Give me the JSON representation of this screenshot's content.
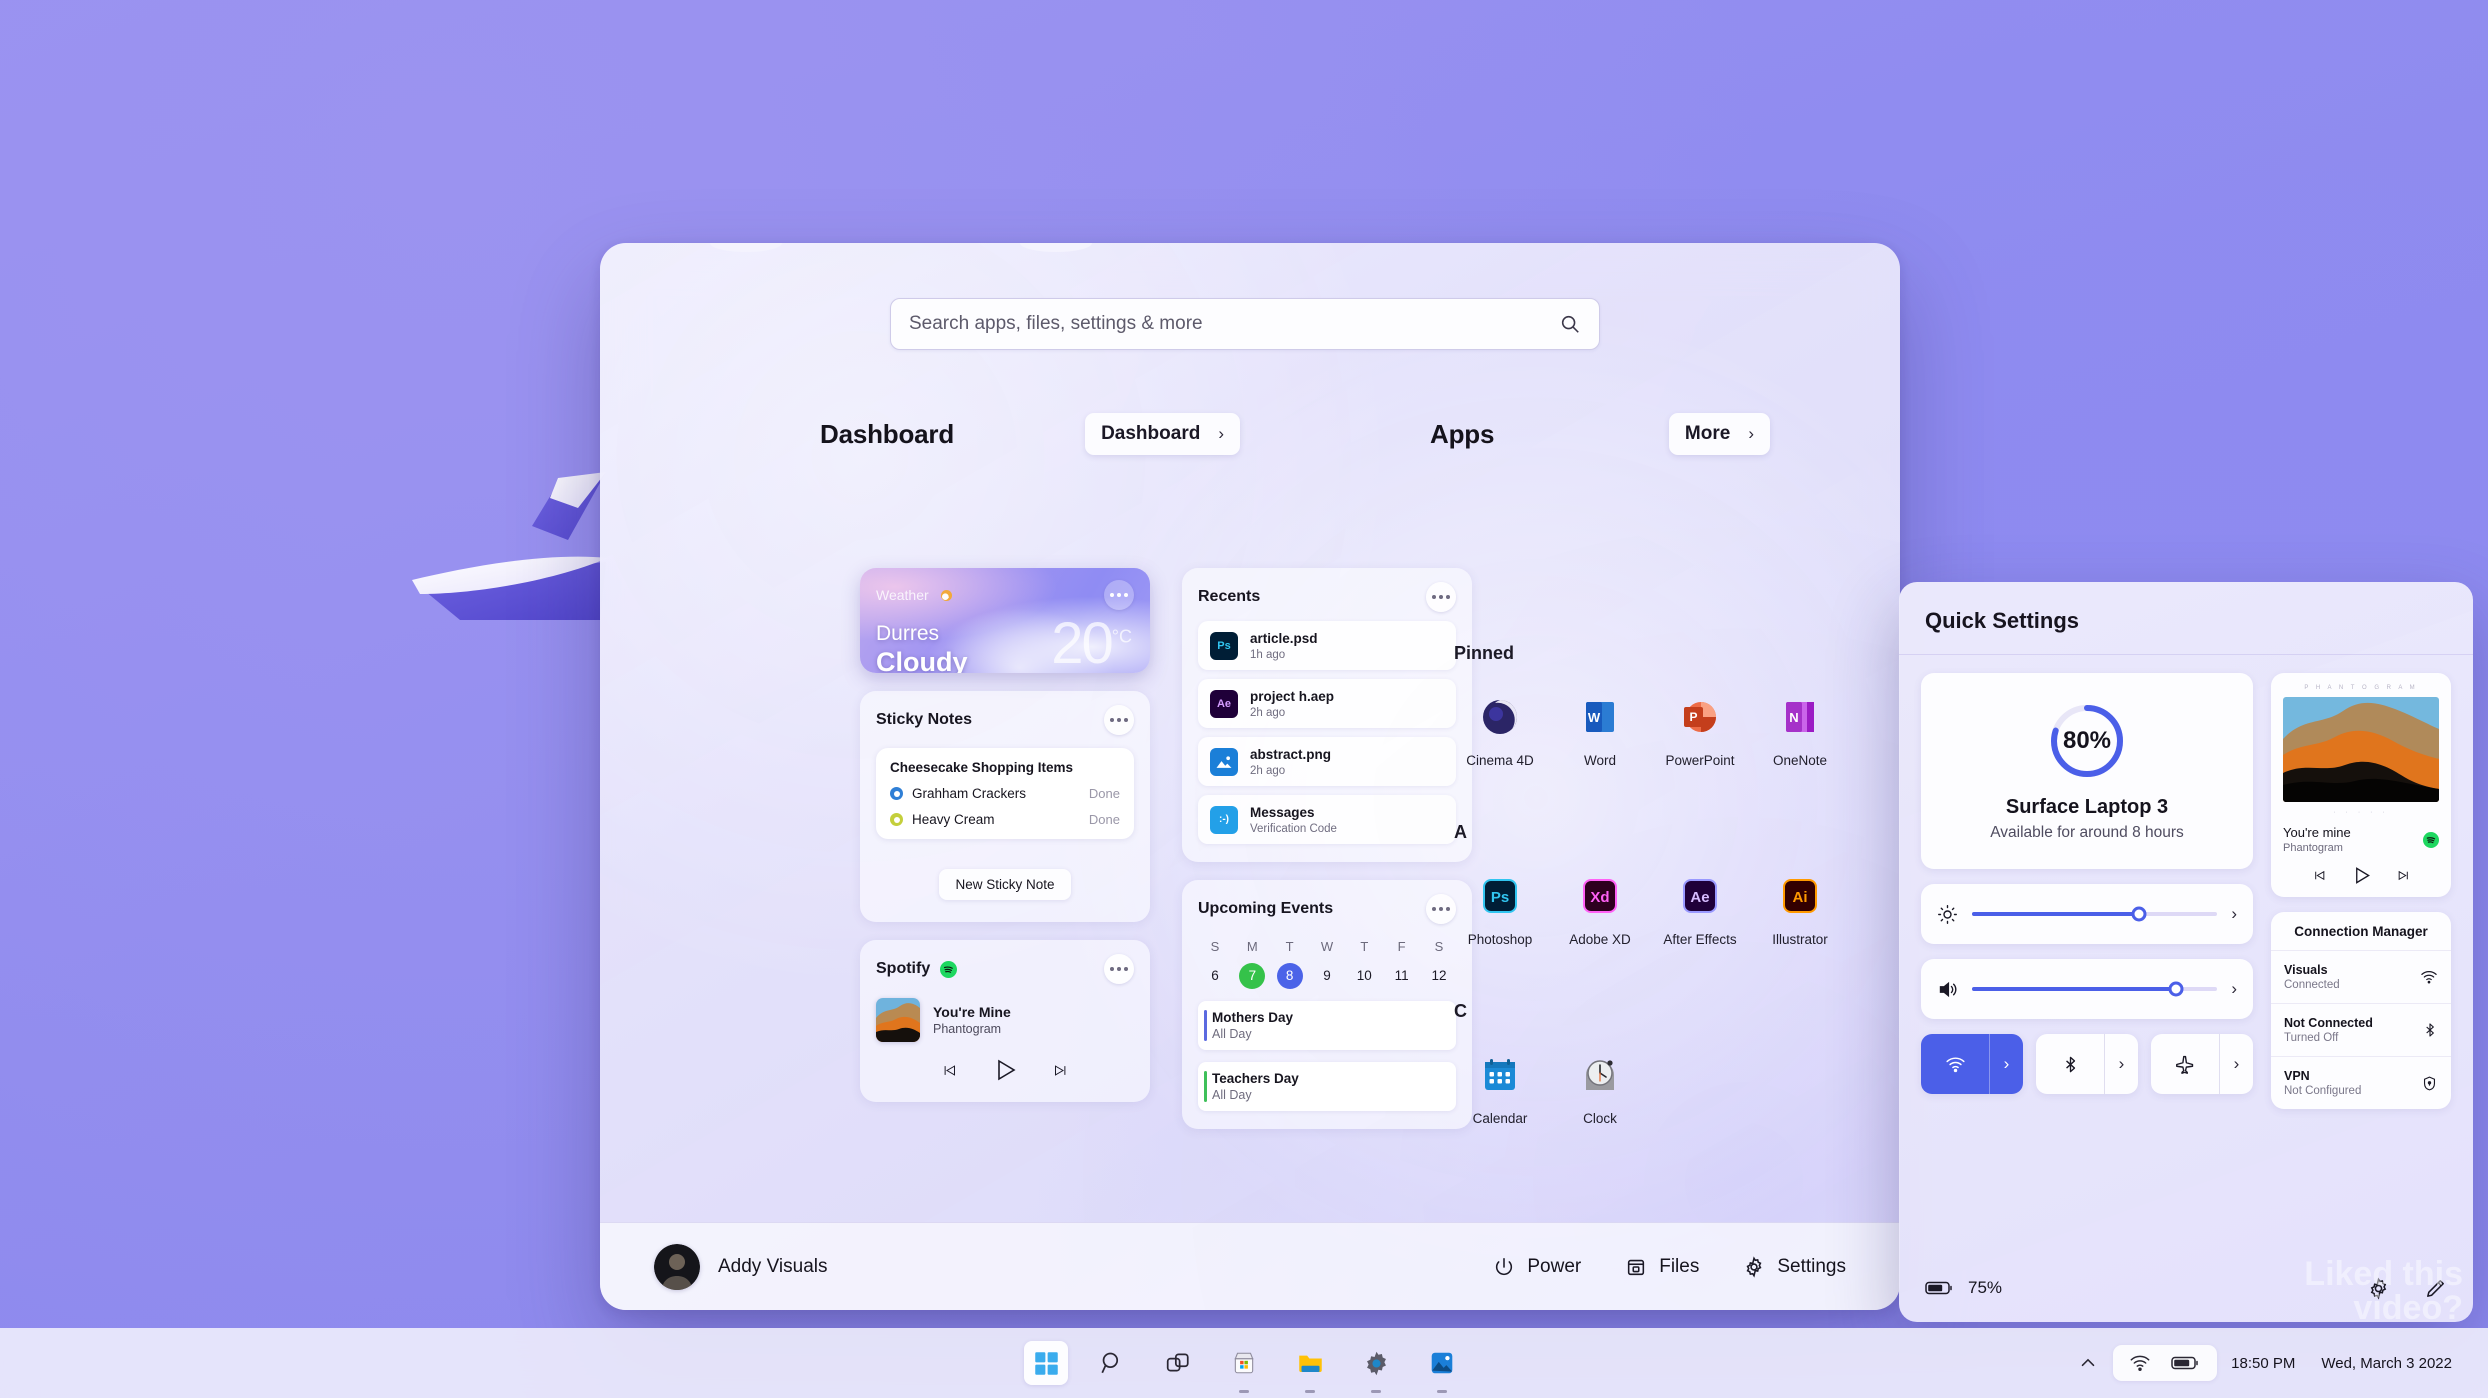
{
  "desktop": {
    "watermark_line1": "Liked this",
    "watermark_line2": "video?"
  },
  "start_menu": {
    "search": {
      "placeholder": "Search apps, files, settings & more",
      "value": "",
      "icon": "search-icon"
    },
    "dashboard": {
      "section_title": "Dashboard",
      "button_label": "Dashboard",
      "button_chevron": "›",
      "weather": {
        "title": "Weather",
        "icon": "sun-cloud-icon",
        "city": "Durres",
        "condition": "Cloudy",
        "temperature": "20",
        "unit": "°C",
        "menu_icon": "more-dots-icon"
      },
      "sticky_notes": {
        "title": "Sticky Notes",
        "menu_icon": "more-dots-icon",
        "note_title": "Cheesecake Shopping Items",
        "items": [
          {
            "label": "Grahham Crackers",
            "status": "Done",
            "color": "#2f7fd6"
          },
          {
            "label": "Heavy Cream",
            "status": "Done",
            "color": "#c4cf3c"
          }
        ],
        "new_note_label": "New Sticky Note"
      },
      "spotify": {
        "title": "Spotify",
        "icon": "spotify-icon",
        "menu_icon": "more-dots-icon",
        "track": "You're Mine",
        "artist": "Phantogram",
        "controls": [
          "prev-icon",
          "play-icon",
          "next-icon"
        ]
      },
      "recents": {
        "title": "Recents",
        "menu_icon": "more-dots-icon",
        "items": [
          {
            "name": "article.psd",
            "meta": "1h ago",
            "icon": "photoshop-icon",
            "color": "#001e36",
            "badge": "Ps"
          },
          {
            "name": "project h.aep",
            "meta": "2h ago",
            "icon": "aftereffects-icon",
            "color": "#1f0039",
            "badge": "Ae"
          },
          {
            "name": "abstract.png",
            "meta": "2h ago",
            "icon": "image-icon",
            "color": "#1b7fd8",
            "badge": ""
          },
          {
            "name": "Messages",
            "meta": "Verification Code",
            "icon": "messages-icon",
            "color": "#23a0e8",
            "badge": ":-)"
          }
        ]
      },
      "events": {
        "title": "Upcoming Events",
        "menu_icon": "more-dots-icon",
        "day_labels": [
          "S",
          "M",
          "T",
          "W",
          "T",
          "F",
          "S"
        ],
        "days": [
          {
            "n": "6",
            "state": ""
          },
          {
            "n": "7",
            "state": "g"
          },
          {
            "n": "8",
            "state": "b"
          },
          {
            "n": "9",
            "state": ""
          },
          {
            "n": "10",
            "state": ""
          },
          {
            "n": "11",
            "state": ""
          },
          {
            "n": "12",
            "state": ""
          }
        ],
        "list": [
          {
            "name": "Mothers Day",
            "time": "All Day",
            "color": "#5b6ae0"
          },
          {
            "name": "Teachers Day",
            "time": "All Day",
            "color": "#3fc05a"
          }
        ]
      }
    },
    "apps": {
      "section_title": "Apps",
      "button_label": "More",
      "button_chevron": "›",
      "groups": [
        {
          "heading": "Pinned",
          "items": [
            {
              "label": "Cinema 4D",
              "icon": "cinema4d-icon"
            },
            {
              "label": "Word",
              "icon": "word-icon"
            },
            {
              "label": "PowerPoint",
              "icon": "powerpoint-icon"
            },
            {
              "label": "OneNote",
              "icon": "onenote-icon"
            }
          ]
        },
        {
          "heading": "A",
          "items": [
            {
              "label": "Photoshop",
              "icon": "photoshop-icon"
            },
            {
              "label": "Adobe XD",
              "icon": "adobexd-icon"
            },
            {
              "label": "After Effects",
              "icon": "aftereffects-icon"
            },
            {
              "label": "Illustrator",
              "icon": "illustrator-icon"
            }
          ]
        },
        {
          "heading": "C",
          "items": [
            {
              "label": "Calendar",
              "icon": "calendar-icon"
            },
            {
              "label": "Clock",
              "icon": "clock-icon"
            }
          ]
        }
      ]
    },
    "footer": {
      "user_name": "Addy Visuals",
      "avatar": "user-avatar",
      "buttons": [
        {
          "label": "Power",
          "icon": "power-icon"
        },
        {
          "label": "Files",
          "icon": "folder-icon"
        },
        {
          "label": "Settings",
          "icon": "gear-icon"
        }
      ]
    }
  },
  "quick_settings": {
    "title": "Quick Settings",
    "battery": {
      "percent": "80%",
      "device": "Surface Laptop 3",
      "subtitle": "Available for around 8 hours",
      "ring_color": "#4b5fe8"
    },
    "media": {
      "band_text": "P H A N T O G R A M",
      "dots": "· · · · ·",
      "track": "You're mine",
      "artist": "Phantogram",
      "service_icon": "spotify-icon",
      "controls": [
        "prev-icon",
        "play-icon",
        "next-icon"
      ]
    },
    "sliders": [
      {
        "icon": "brightness-icon",
        "value": 68,
        "chevron": "›"
      },
      {
        "icon": "volume-icon",
        "value": 83,
        "chevron": "›"
      }
    ],
    "toggles": [
      {
        "icon": "wifi-icon",
        "on": true,
        "chevron": "›"
      },
      {
        "icon": "bluetooth-icon",
        "on": false,
        "chevron": "›"
      },
      {
        "icon": "airplane-icon",
        "on": false,
        "chevron": "›"
      }
    ],
    "connection_manager": {
      "title": "Connection Manager",
      "rows": [
        {
          "name": "Visuals",
          "status": "Connected",
          "icon": "wifi-icon"
        },
        {
          "name": "Not Connected",
          "status": "Turned Off",
          "icon": "bluetooth-icon"
        },
        {
          "name": "VPN",
          "status": "Not Configured",
          "icon": "shield-icon"
        }
      ]
    },
    "footer": {
      "battery_percent": "75%",
      "battery_icon": "battery-icon",
      "icons": [
        "gear-icon",
        "pencil-icon"
      ]
    }
  },
  "taskbar": {
    "apps": [
      {
        "icon": "start-icon",
        "active": true,
        "running": false
      },
      {
        "icon": "search-icon",
        "active": false,
        "running": false
      },
      {
        "icon": "taskview-icon",
        "active": false,
        "running": false
      },
      {
        "icon": "store-icon",
        "active": false,
        "running": true
      },
      {
        "icon": "fileexplorer-icon",
        "active": false,
        "running": true
      },
      {
        "icon": "settings-icon",
        "active": false,
        "running": true
      },
      {
        "icon": "photos-icon",
        "active": false,
        "running": true
      }
    ],
    "tray": {
      "chevron_icon": "chevron-up-icon",
      "wifi_icon": "wifi-icon",
      "battery_icon": "battery-icon",
      "time": "18:50 PM",
      "date": "Wed, March 3 2022"
    }
  }
}
